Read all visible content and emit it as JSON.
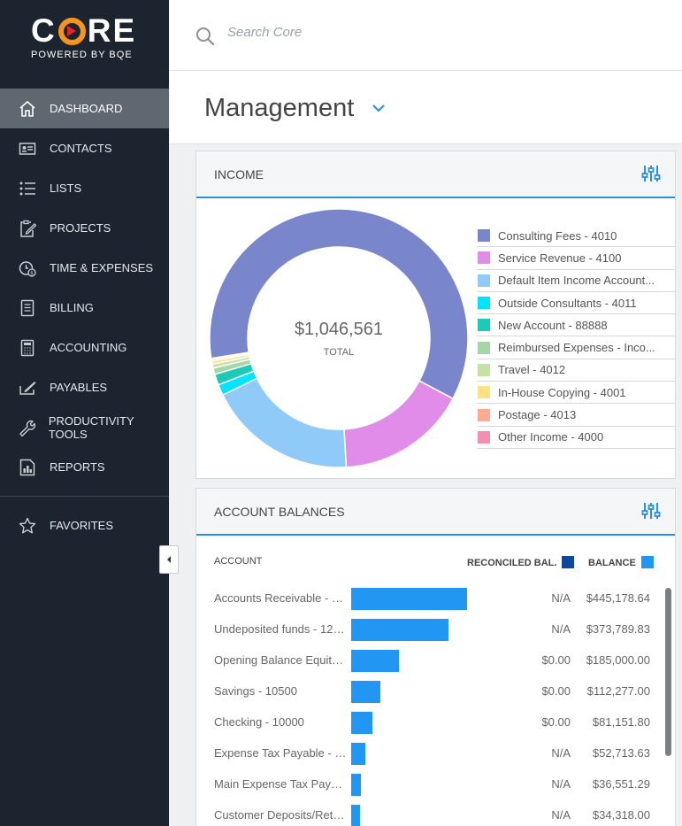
{
  "brand": {
    "logo_c": "C",
    "logo_re": "RE",
    "tagline": "POWERED BY BQE"
  },
  "nav": {
    "items": [
      {
        "label": "DASHBOARD",
        "icon": "home-icon",
        "active": true
      },
      {
        "label": "CONTACTS",
        "icon": "contact-card-icon"
      },
      {
        "label": "LISTS",
        "icon": "list-icon"
      },
      {
        "label": "PROJECTS",
        "icon": "clipboard-icon"
      },
      {
        "label": "TIME & EXPENSES",
        "icon": "clock-dollar-icon"
      },
      {
        "label": "BILLING",
        "icon": "invoice-icon"
      },
      {
        "label": "ACCOUNTING",
        "icon": "calculator-icon"
      },
      {
        "label": "PAYABLES",
        "icon": "check-pen-icon"
      },
      {
        "label": "PRODUCTIVITY TOOLS",
        "icon": "wrench-icon"
      },
      {
        "label": "REPORTS",
        "icon": "report-chart-icon"
      }
    ],
    "favorites": {
      "label": "FAVORITES",
      "icon": "star-icon"
    }
  },
  "search": {
    "placeholder": "Search Core"
  },
  "page": {
    "title": "Management"
  },
  "income": {
    "title": "INCOME",
    "total": "$1,046,561",
    "total_label": "TOTAL",
    "legend": [
      {
        "label": "Consulting Fees - 4010",
        "color": "#7986cb"
      },
      {
        "label": "Service Revenue - 4100",
        "color": "#e08ce8"
      },
      {
        "label": "Default Item Income Account...",
        "color": "#90caf9"
      },
      {
        "label": "Outside Consultants - 4011",
        "color": "#00e5ff"
      },
      {
        "label": "New Account - 88888",
        "color": "#1dc9b7"
      },
      {
        "label": "Reimbursed Expenses - Inco...",
        "color": "#a5d6a7"
      },
      {
        "label": "Travel - 4012",
        "color": "#c5e1a5"
      },
      {
        "label": "In-House Copying - 4001",
        "color": "#ffe082"
      },
      {
        "label": "Postage - 4013",
        "color": "#ffab91"
      },
      {
        "label": "Other Income - 4000",
        "color": "#f48fb1"
      }
    ]
  },
  "chart_data": {
    "type": "pie",
    "title": "INCOME",
    "total": 1046561,
    "categories": [
      "Consulting Fees - 4010",
      "Service Revenue - 4100",
      "Default Item Income Account",
      "Outside Consultants - 4011",
      "New Account - 88888",
      "Reimbursed Expenses - Income",
      "Travel - 4012",
      "In-House Copying - 4001",
      "Postage - 4013",
      "Other Income - 4000"
    ],
    "values": [
      616000,
      167000,
      191000,
      14000,
      14000,
      8000,
      5000,
      4000,
      2000,
      1500
    ],
    "colors": [
      "#7986cb",
      "#e08ce8",
      "#90caf9",
      "#00e5ff",
      "#1dc9b7",
      "#a5d6a7",
      "#c5e1a5",
      "#ffe082",
      "#ffab91",
      "#f48fb1"
    ]
  },
  "balances": {
    "title": "ACCOUNT BALANCES",
    "col_account": "ACCOUNT",
    "col_reconciled": "RECONCILED BAL.",
    "col_balance": "BALANCE",
    "reconciled_color": "#0d47a1",
    "balance_color": "#2196f3",
    "rows": [
      {
        "name": "Accounts Receivable - 11...",
        "reconciled": "N/A",
        "balance": "$445,178.64",
        "value": 445178.64
      },
      {
        "name": "Undeposited funds - 12000",
        "reconciled": "N/A",
        "balance": "$373,789.83",
        "value": 373789.83
      },
      {
        "name": "Opening Balance Equity -...",
        "reconciled": "$0.00",
        "balance": "$185,000.00",
        "value": 185000.0
      },
      {
        "name": "Savings - 10500",
        "reconciled": "$0.00",
        "balance": "$112,277.00",
        "value": 112277.0
      },
      {
        "name": "Checking - 10000",
        "reconciled": "$0.00",
        "balance": "$81,151.80",
        "value": 81151.8
      },
      {
        "name": "Expense Tax Payable - 25...",
        "reconciled": "N/A",
        "balance": "$52,713.63",
        "value": 52713.63
      },
      {
        "name": "Main Expense Tax Payabl...",
        "reconciled": "N/A",
        "balance": "$36,551.29",
        "value": 36551.29
      },
      {
        "name": "Customer Deposits/Retai...",
        "reconciled": "N/A",
        "balance": "$34,318.00",
        "value": 34318.0
      }
    ]
  }
}
